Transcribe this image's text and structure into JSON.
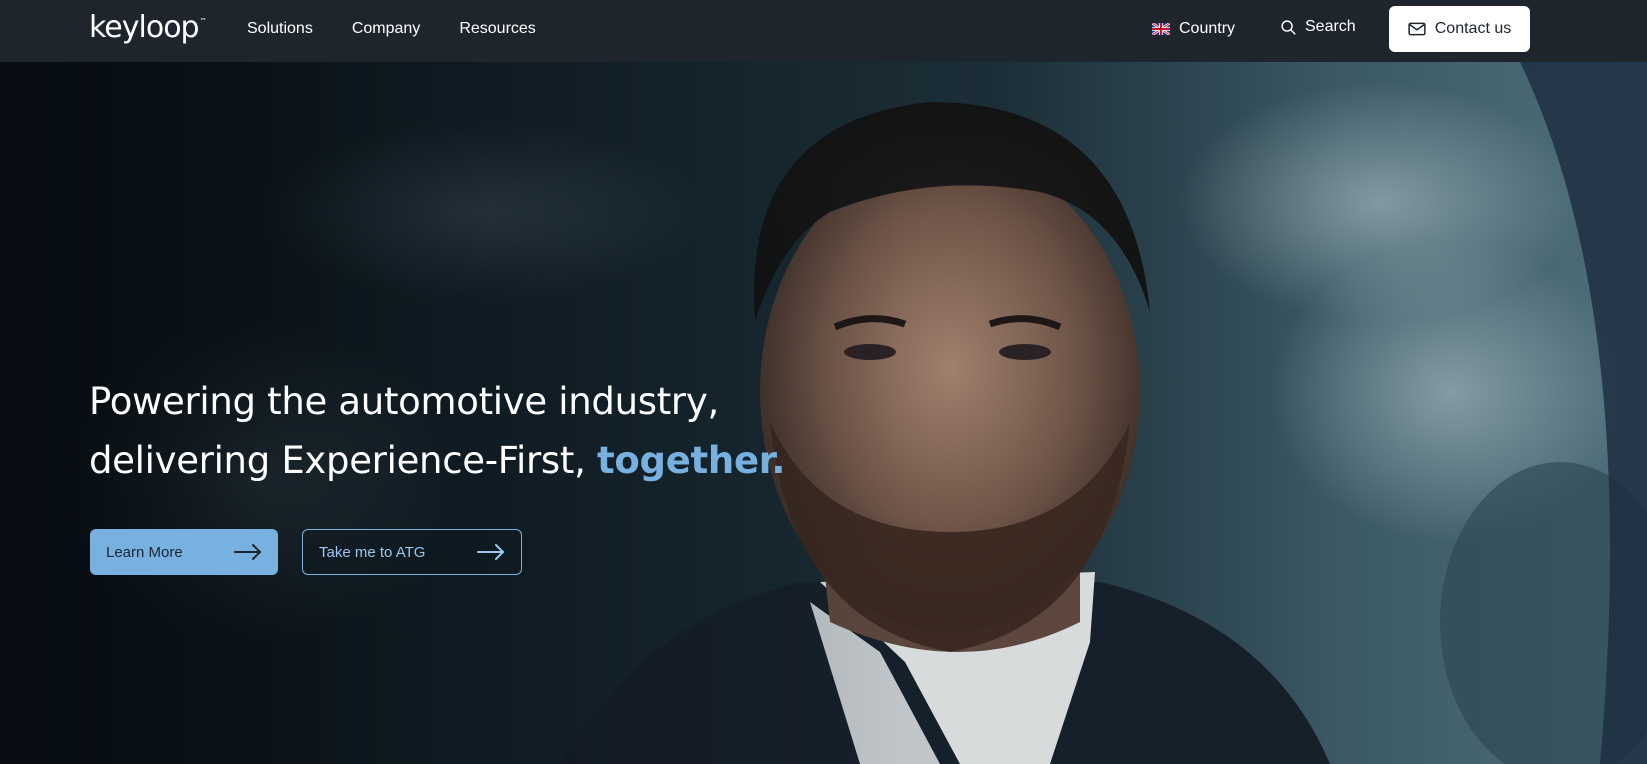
{
  "header": {
    "logo_text": "keyloop",
    "logo_tm": "™",
    "nav": [
      {
        "label": "Solutions"
      },
      {
        "label": "Company"
      },
      {
        "label": "Resources"
      }
    ],
    "country_label": "Country",
    "search_label": "Search",
    "contact_label": "Contact us"
  },
  "hero": {
    "headline_line1": "Powering the automotive industry,",
    "headline_line2_prefix": "delivering Experience-First, ",
    "headline_accent": "together.",
    "buttons": [
      {
        "label": "Learn More"
      },
      {
        "label": "Take me to ATG"
      }
    ]
  },
  "colors": {
    "header_bg": "#1f252d",
    "accent": "#78b0e0",
    "contact_bg": "#ffffff"
  },
  "icons": {
    "flag": "uk-flag-icon",
    "search": "search-icon",
    "contact": "mail-icon",
    "cta_arrow": "arrow-right-icon"
  }
}
